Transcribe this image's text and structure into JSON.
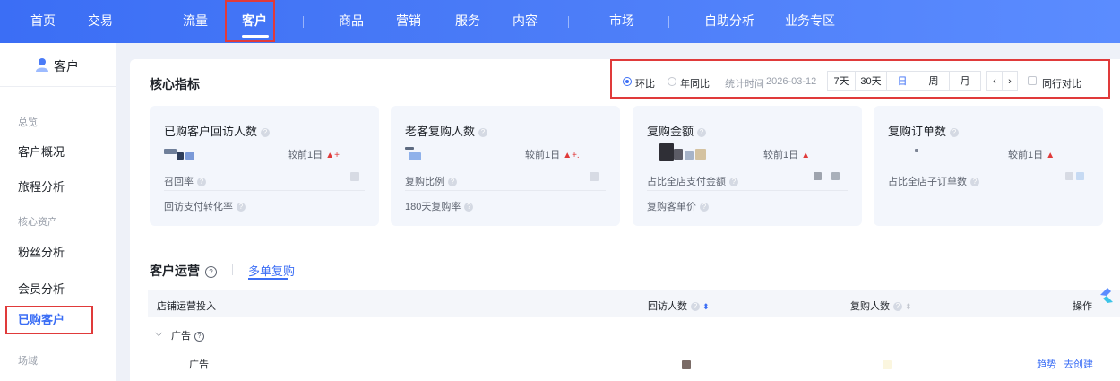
{
  "topnav": {
    "items": [
      {
        "label": "首页"
      },
      {
        "label": "交易"
      },
      {
        "label": "流量"
      },
      {
        "label": "客户"
      },
      {
        "label": "商品"
      },
      {
        "label": "营销"
      },
      {
        "label": "服务"
      },
      {
        "label": "内容"
      },
      {
        "label": "市场"
      },
      {
        "label": "自助分析"
      },
      {
        "label": "业务专区"
      }
    ],
    "active": "客户"
  },
  "sidebar": {
    "title": "客户",
    "groups": [
      {
        "label": "总览",
        "items": [
          {
            "label": "客户概况"
          },
          {
            "label": "旅程分析"
          }
        ]
      },
      {
        "label": "核心资产",
        "items": [
          {
            "label": "粉丝分析"
          },
          {
            "label": "会员分析"
          },
          {
            "label": "已购客户"
          }
        ]
      },
      {
        "label": "场域",
        "items": []
      }
    ],
    "active": "已购客户"
  },
  "core": {
    "title": "核心指标",
    "filters": {
      "mom_label": "环比",
      "yoy_label": "年同比",
      "stat_time_label": "统计时间",
      "stat_date": "2026-03-12",
      "periods": [
        {
          "label": "7天"
        },
        {
          "label": "30天"
        },
        {
          "label": "日"
        },
        {
          "label": "周"
        },
        {
          "label": "月"
        }
      ],
      "active_period": "日",
      "prev_label": "‹",
      "next_label": "›",
      "peer_compare_label": "同行对比"
    },
    "metrics": [
      {
        "title": "已购客户回访人数",
        "compare": "较前1日",
        "delta": "+",
        "subs": [
          "召回率",
          "回访支付转化率"
        ]
      },
      {
        "title": "老客复购人数",
        "compare": "较前1日",
        "delta": "+.",
        "subs": [
          "复购比例",
          "180天复购率"
        ]
      },
      {
        "title": "复购金额",
        "compare": "较前1日",
        "delta": "",
        "subs": [
          "占比全店支付金额",
          "复购客单价"
        ]
      },
      {
        "title": "复购订单数",
        "compare": "较前1日",
        "delta": "",
        "subs": [
          "占比全店子订单数"
        ]
      }
    ]
  },
  "ops": {
    "title": "客户运营",
    "help": "?",
    "tab": "多单复购",
    "table": {
      "headers": [
        "店铺运营投入",
        "回访人数",
        "复购人数",
        "操作"
      ],
      "group_row": {
        "label": "广告"
      },
      "row": {
        "label": "广告",
        "actions": [
          "趋势",
          "去创建"
        ]
      }
    }
  },
  "colors": {
    "brand": "#3b6ef5",
    "highlight_border": "#e03a3a",
    "up": "#e03a3a"
  }
}
